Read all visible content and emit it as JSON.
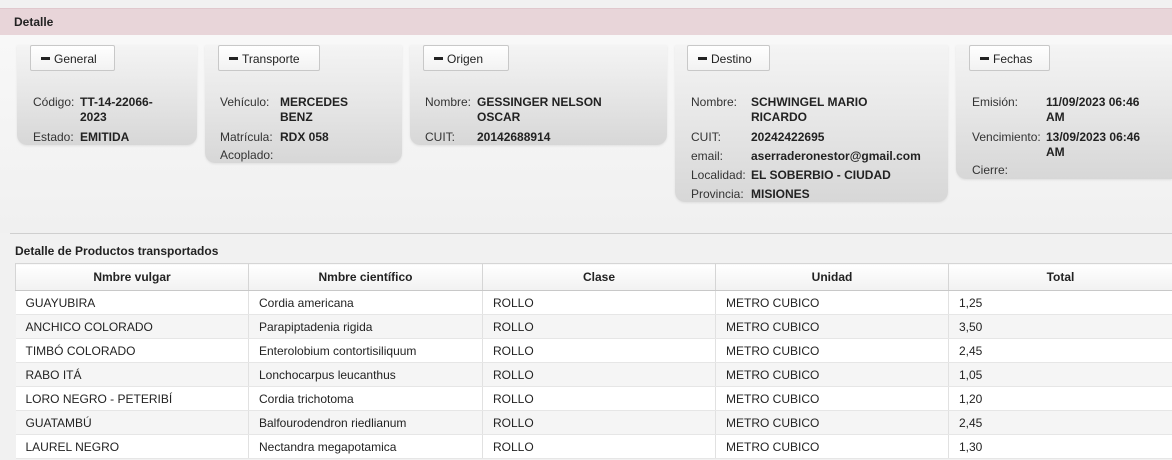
{
  "header": {
    "title": "Detalle"
  },
  "cards": {
    "general": {
      "button": "General",
      "codigo_label": "Código:",
      "codigo_value_1": "TT-14-22066-",
      "codigo_value_2": "2023",
      "estado_label": "Estado:",
      "estado_value": "EMITIDA"
    },
    "transporte": {
      "button": "Transporte",
      "vehiculo_label": "Vehículo:",
      "vehiculo_value_1": "MERCEDES",
      "vehiculo_value_2": "BENZ",
      "matricula_label": "Matrícula:",
      "matricula_value": "RDX 058",
      "acoplado_label": "Acoplado:"
    },
    "origen": {
      "button": "Origen",
      "nombre_label": "Nombre:",
      "nombre_value_1": "GESSINGER NELSON",
      "nombre_value_2": "OSCAR",
      "cuit_label": "CUIT:",
      "cuit_value": "20142688914"
    },
    "destino": {
      "button": "Destino",
      "nombre_label": "Nombre:",
      "nombre_value_1": "SCHWINGEL MARIO",
      "nombre_value_2": "RICARDO",
      "cuit_label": "CUIT:",
      "cuit_value": "20242422695",
      "email_label": "email:",
      "email_value": "aserraderonestor@gmail.com",
      "localidad_label": "Localidad:",
      "localidad_value": "EL SOBERBIO - CIUDAD",
      "provincia_label": "Provincia:",
      "provincia_value": "MISIONES"
    },
    "fechas": {
      "button": "Fechas",
      "emision_label": "Emisión:",
      "emision_value_1": "11/09/2023 06:46",
      "emision_value_2": "AM",
      "vencimiento_label": "Vencimiento:",
      "vencimiento_value_1": "13/09/2023 06:46",
      "vencimiento_value_2": "AM",
      "cierre_label": "Cierre:"
    }
  },
  "products": {
    "title": "Detalle de Productos transportados",
    "columns": [
      "Nmbre vulgar",
      "Nmbre científico",
      "Clase",
      "Unidad",
      "Total"
    ],
    "rows": [
      [
        "GUAYUBIRA",
        "Cordia americana",
        "ROLLO",
        "METRO CUBICO",
        "1,25"
      ],
      [
        "ANCHICO COLORADO",
        "Parapiptadenia rigida",
        "ROLLO",
        "METRO CUBICO",
        "3,50"
      ],
      [
        "TIMBÓ COLORADO",
        "Enterolobium contortisiliquum",
        "ROLLO",
        "METRO CUBICO",
        "2,45"
      ],
      [
        "RABO ITÁ",
        "Lonchocarpus leucanthus",
        "ROLLO",
        "METRO CUBICO",
        "1,05"
      ],
      [
        "LORO NEGRO - PETERIBÍ",
        "Cordia trichotoma",
        "ROLLO",
        "METRO CUBICO",
        "1,20"
      ],
      [
        "GUATAMBÚ",
        "Balfourodendron riedlianum",
        "ROLLO",
        "METRO CUBICO",
        "2,45"
      ],
      [
        "LAUREL NEGRO",
        "Nectandra megapotamica",
        "ROLLO",
        "METRO CUBICO",
        "1,30"
      ]
    ]
  }
}
